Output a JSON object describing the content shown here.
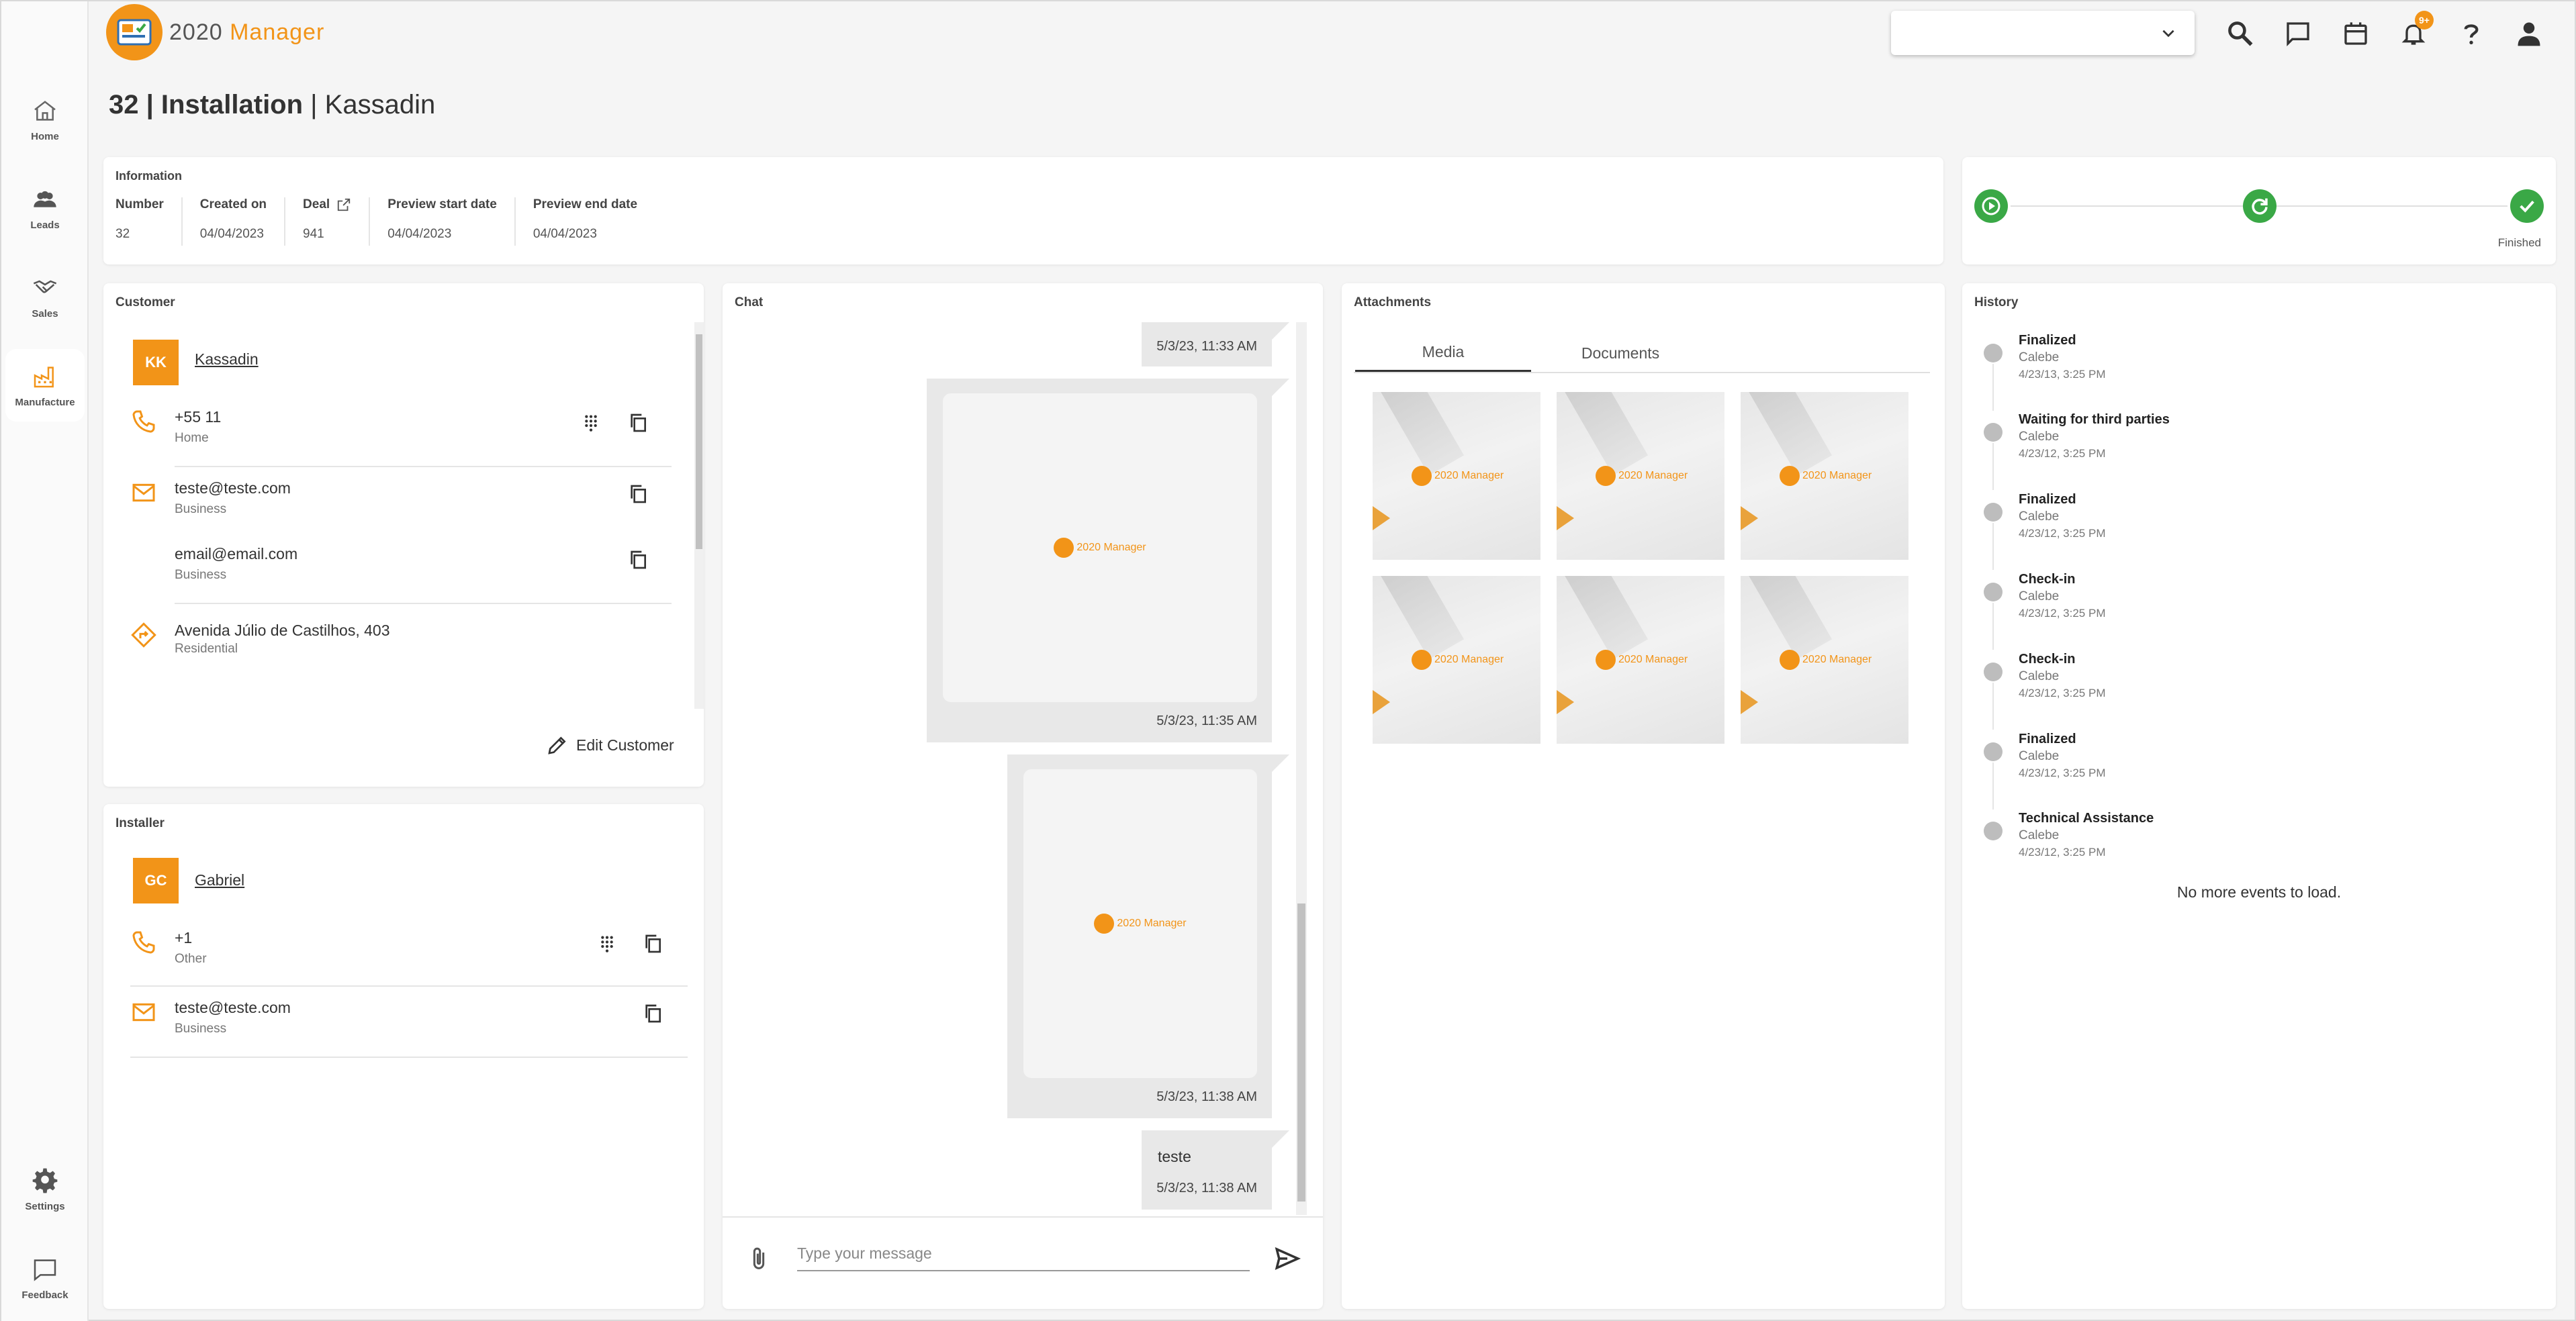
{
  "app": {
    "logo_text": "2020",
    "logo_text2": " Manager"
  },
  "sidebar": {
    "items": [
      {
        "label": "Home"
      },
      {
        "label": "Leads"
      },
      {
        "label": "Sales"
      },
      {
        "label": "Manufacture"
      }
    ],
    "settings": "Settings",
    "feedback": "Feedback"
  },
  "topbar": {
    "notifications_badge": "9+",
    "selector_value": ""
  },
  "page": {
    "id_type": "32 | Installation",
    "name": " | Kassadin"
  },
  "information": {
    "title": "Information",
    "fields": [
      {
        "label": "Number",
        "value": "32"
      },
      {
        "label": "Created on",
        "value": "04/04/2023"
      },
      {
        "label": "Deal",
        "value": "941"
      },
      {
        "label": "Preview start date",
        "value": "04/04/2023"
      },
      {
        "label": "Preview end date",
        "value": "04/04/2023"
      }
    ]
  },
  "status": {
    "label": "Finished",
    "accent": "#3aa846"
  },
  "customer": {
    "title": "Customer",
    "initials": "KK",
    "name": "Kassadin",
    "phone": {
      "value": "+55 11",
      "type": "Home"
    },
    "emails": [
      {
        "value": "teste@teste.com",
        "type": "Business"
      },
      {
        "value": "email@email.com",
        "type": "Business"
      }
    ],
    "address": {
      "value": "Avenida Júlio de Castilhos, 403",
      "type": "Residential"
    },
    "edit_label": "Edit Customer"
  },
  "installer": {
    "title": "Installer",
    "initials": "GC",
    "name": "Gabriel",
    "phone": {
      "value": "+1",
      "type": "Other"
    },
    "email": {
      "value": "teste@teste.com",
      "type": "Business"
    }
  },
  "chat": {
    "title": "Chat",
    "messages": [
      {
        "time": "5/3/23, 11:33 AM"
      },
      {
        "time": "5/3/23, 11:35 AM"
      },
      {
        "time": "5/3/23, 11:38 AM"
      },
      {
        "text": "teste",
        "time": "5/3/23, 11:38 AM"
      }
    ],
    "image_logo": "2020 Manager",
    "input_placeholder": "Type your message"
  },
  "attachments": {
    "title": "Attachments",
    "tabs": [
      {
        "label": "Media"
      },
      {
        "label": "Documents"
      }
    ],
    "thumb_logo": "2020 Manager"
  },
  "history": {
    "title": "History",
    "events": [
      {
        "title": "Finalized",
        "user": "Calebe",
        "date": "4/23/13, 3:25 PM"
      },
      {
        "title": "Waiting for third parties",
        "user": "Calebe",
        "date": "4/23/12, 3:25 PM"
      },
      {
        "title": "Finalized",
        "user": "Calebe",
        "date": "4/23/12, 3:25 PM"
      },
      {
        "title": "Check-in",
        "user": "Calebe",
        "date": "4/23/12, 3:25 PM"
      },
      {
        "title": "Check-in",
        "user": "Calebe",
        "date": "4/23/12, 3:25 PM"
      },
      {
        "title": "Finalized",
        "user": "Calebe",
        "date": "4/23/12, 3:25 PM"
      },
      {
        "title": "Technical Assistance",
        "user": "Calebe",
        "date": "4/23/12, 3:25 PM"
      }
    ],
    "end_text": "No more events to load."
  }
}
